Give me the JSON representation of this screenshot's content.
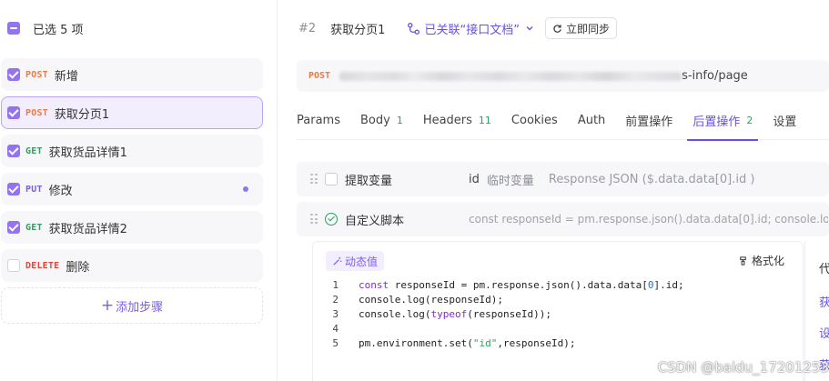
{
  "left_panel": {
    "selected_text": "已选 5 项",
    "steps": [
      {
        "method": "POST",
        "label": "新增",
        "checked": true
      },
      {
        "method": "POST",
        "label": "获取分页1",
        "checked": true,
        "active": true
      },
      {
        "method": "GET",
        "label": "获取货品详情1",
        "checked": true
      },
      {
        "method": "PUT",
        "label": "修改",
        "checked": true,
        "dot": true
      },
      {
        "method": "GET",
        "label": "获取货品详情2",
        "checked": true
      },
      {
        "method": "DELETE",
        "label": "删除",
        "checked": false
      }
    ],
    "add_step_label": "添加步骤"
  },
  "top_bar": {
    "hash": "#2",
    "title": "获取分页1",
    "linked_label": "已关联“接口文档”",
    "sync_label": "立即同步"
  },
  "url_bar": {
    "method": "POST",
    "url_tail": "s-info/page"
  },
  "tabs": [
    {
      "label": "Params",
      "count": ""
    },
    {
      "label": "Body",
      "count": "1"
    },
    {
      "label": "Headers",
      "count": "11"
    },
    {
      "label": "Cookies",
      "count": ""
    },
    {
      "label": "Auth",
      "count": ""
    },
    {
      "label": "前置操作",
      "count": ""
    },
    {
      "label": "后置操作",
      "count": "2",
      "active": true
    },
    {
      "label": "设置",
      "count": ""
    }
  ],
  "processors": {
    "extract": {
      "title": "提取变量",
      "var_name": "id",
      "var_type": "临时变量",
      "source": "Response JSON ($.data.data[0].id )"
    },
    "script": {
      "title": "自定义脚本",
      "preview": "const responseId = pm.response.json().data.data[0].id; console.log"
    }
  },
  "editor": {
    "dynamic_label": "动态值",
    "format_label": "格式化",
    "line_numbers": [
      "1",
      "2",
      "3",
      "4",
      "5"
    ]
  },
  "side_panel": {
    "items": [
      "代",
      "获",
      "设",
      "获"
    ]
  },
  "watermark": "CSDN @baidu_17201253",
  "colors": {
    "accent": "#6a51e0",
    "post": "#f0793b",
    "get": "#2e9f62",
    "put": "#7c5cef",
    "delete": "#e9433b"
  }
}
